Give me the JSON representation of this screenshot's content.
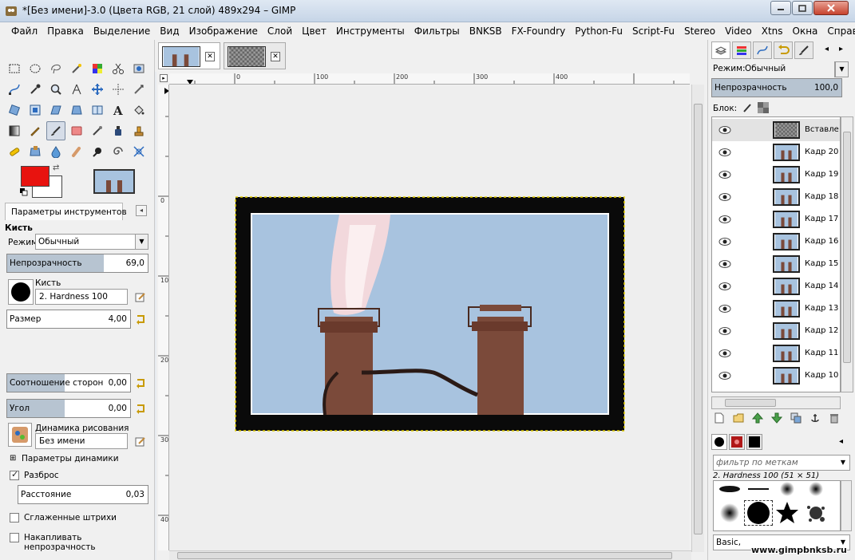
{
  "window": {
    "title": "*[Без имени]-3.0 (Цвета RGB, 21 слой) 489x294 – GIMP"
  },
  "menu": [
    {
      "label": "Файл"
    },
    {
      "label": "Правка"
    },
    {
      "label": "Выделение"
    },
    {
      "label": "Вид"
    },
    {
      "label": "Изображение"
    },
    {
      "label": "Слой"
    },
    {
      "label": "Цвет"
    },
    {
      "label": "Инструменты"
    },
    {
      "label": "Фильтры"
    },
    {
      "label": "BNKSB"
    },
    {
      "label": "FX-Foundry"
    },
    {
      "label": "Python-Fu"
    },
    {
      "label": "Script-Fu"
    },
    {
      "label": "Stereo"
    },
    {
      "label": "Video"
    },
    {
      "label": "Xtns"
    },
    {
      "label": "Окна"
    },
    {
      "label": "Справка"
    }
  ],
  "colors": {
    "foreground": "#e8130f",
    "background": "#ffffff",
    "sky": "#a8c3df",
    "chimney": "#7b4a3a",
    "selection_fill": "#b7c4d1"
  },
  "tool_options": {
    "tab_label": "Параметры инструментов",
    "tool_name": "Кисть",
    "mode_label": "Режим:",
    "mode_value": "Обычный",
    "opacity_label": "Непрозрачность",
    "opacity_value": "69,0",
    "opacity_fraction": 0.69,
    "brush_label": "Кисть",
    "brush_value": "2. Hardness 100",
    "size_label": "Размер",
    "size_value": "4,00",
    "aspect_label": "Соотношение сторон",
    "aspect_value": "0,00",
    "angle_label": "Угол",
    "angle_value": "0,00",
    "dynamics_label": "Динамика рисования",
    "dynamics_value": "Без имени",
    "dynamics_params_label": "Параметры динамики",
    "scatter_label": "Разброс",
    "scatter_checked": true,
    "distance_label": "Расстояние",
    "distance_value": "0,03",
    "smooth_label": "Сглаженные штрихи",
    "smooth_checked": false,
    "accumulate_label": "Накапливать непрозрачность",
    "accumulate_checked": false
  },
  "rulers": {
    "horizontal": [
      "0",
      "100",
      "200",
      "300",
      "400"
    ],
    "vertical": [
      "0",
      "100",
      "200",
      "300",
      "400"
    ]
  },
  "layers_panel": {
    "mode_label": "Режим:",
    "mode_value": "Обычный",
    "opacity_label": "Непрозрачность",
    "opacity_value": "100,0",
    "lock_label": "Блок:",
    "layers": [
      {
        "name": "Вставле",
        "selected": true,
        "thumb": "checker"
      },
      {
        "name": "Кадр 20"
      },
      {
        "name": "Кадр 19"
      },
      {
        "name": "Кадр 18"
      },
      {
        "name": "Кадр 17"
      },
      {
        "name": "Кадр 16"
      },
      {
        "name": "Кадр 15"
      },
      {
        "name": "Кадр 14"
      },
      {
        "name": "Кадр 13"
      },
      {
        "name": "Кадр 12"
      },
      {
        "name": "Кадр 11"
      },
      {
        "name": "Кадр 10"
      }
    ]
  },
  "brushes_panel": {
    "filter_placeholder": "фильтр по меткам",
    "brush_info": "2. Hardness 100 (51 × 51)",
    "preset_value": "Basic,"
  },
  "watermark": "www.gimpbnksb.ru"
}
